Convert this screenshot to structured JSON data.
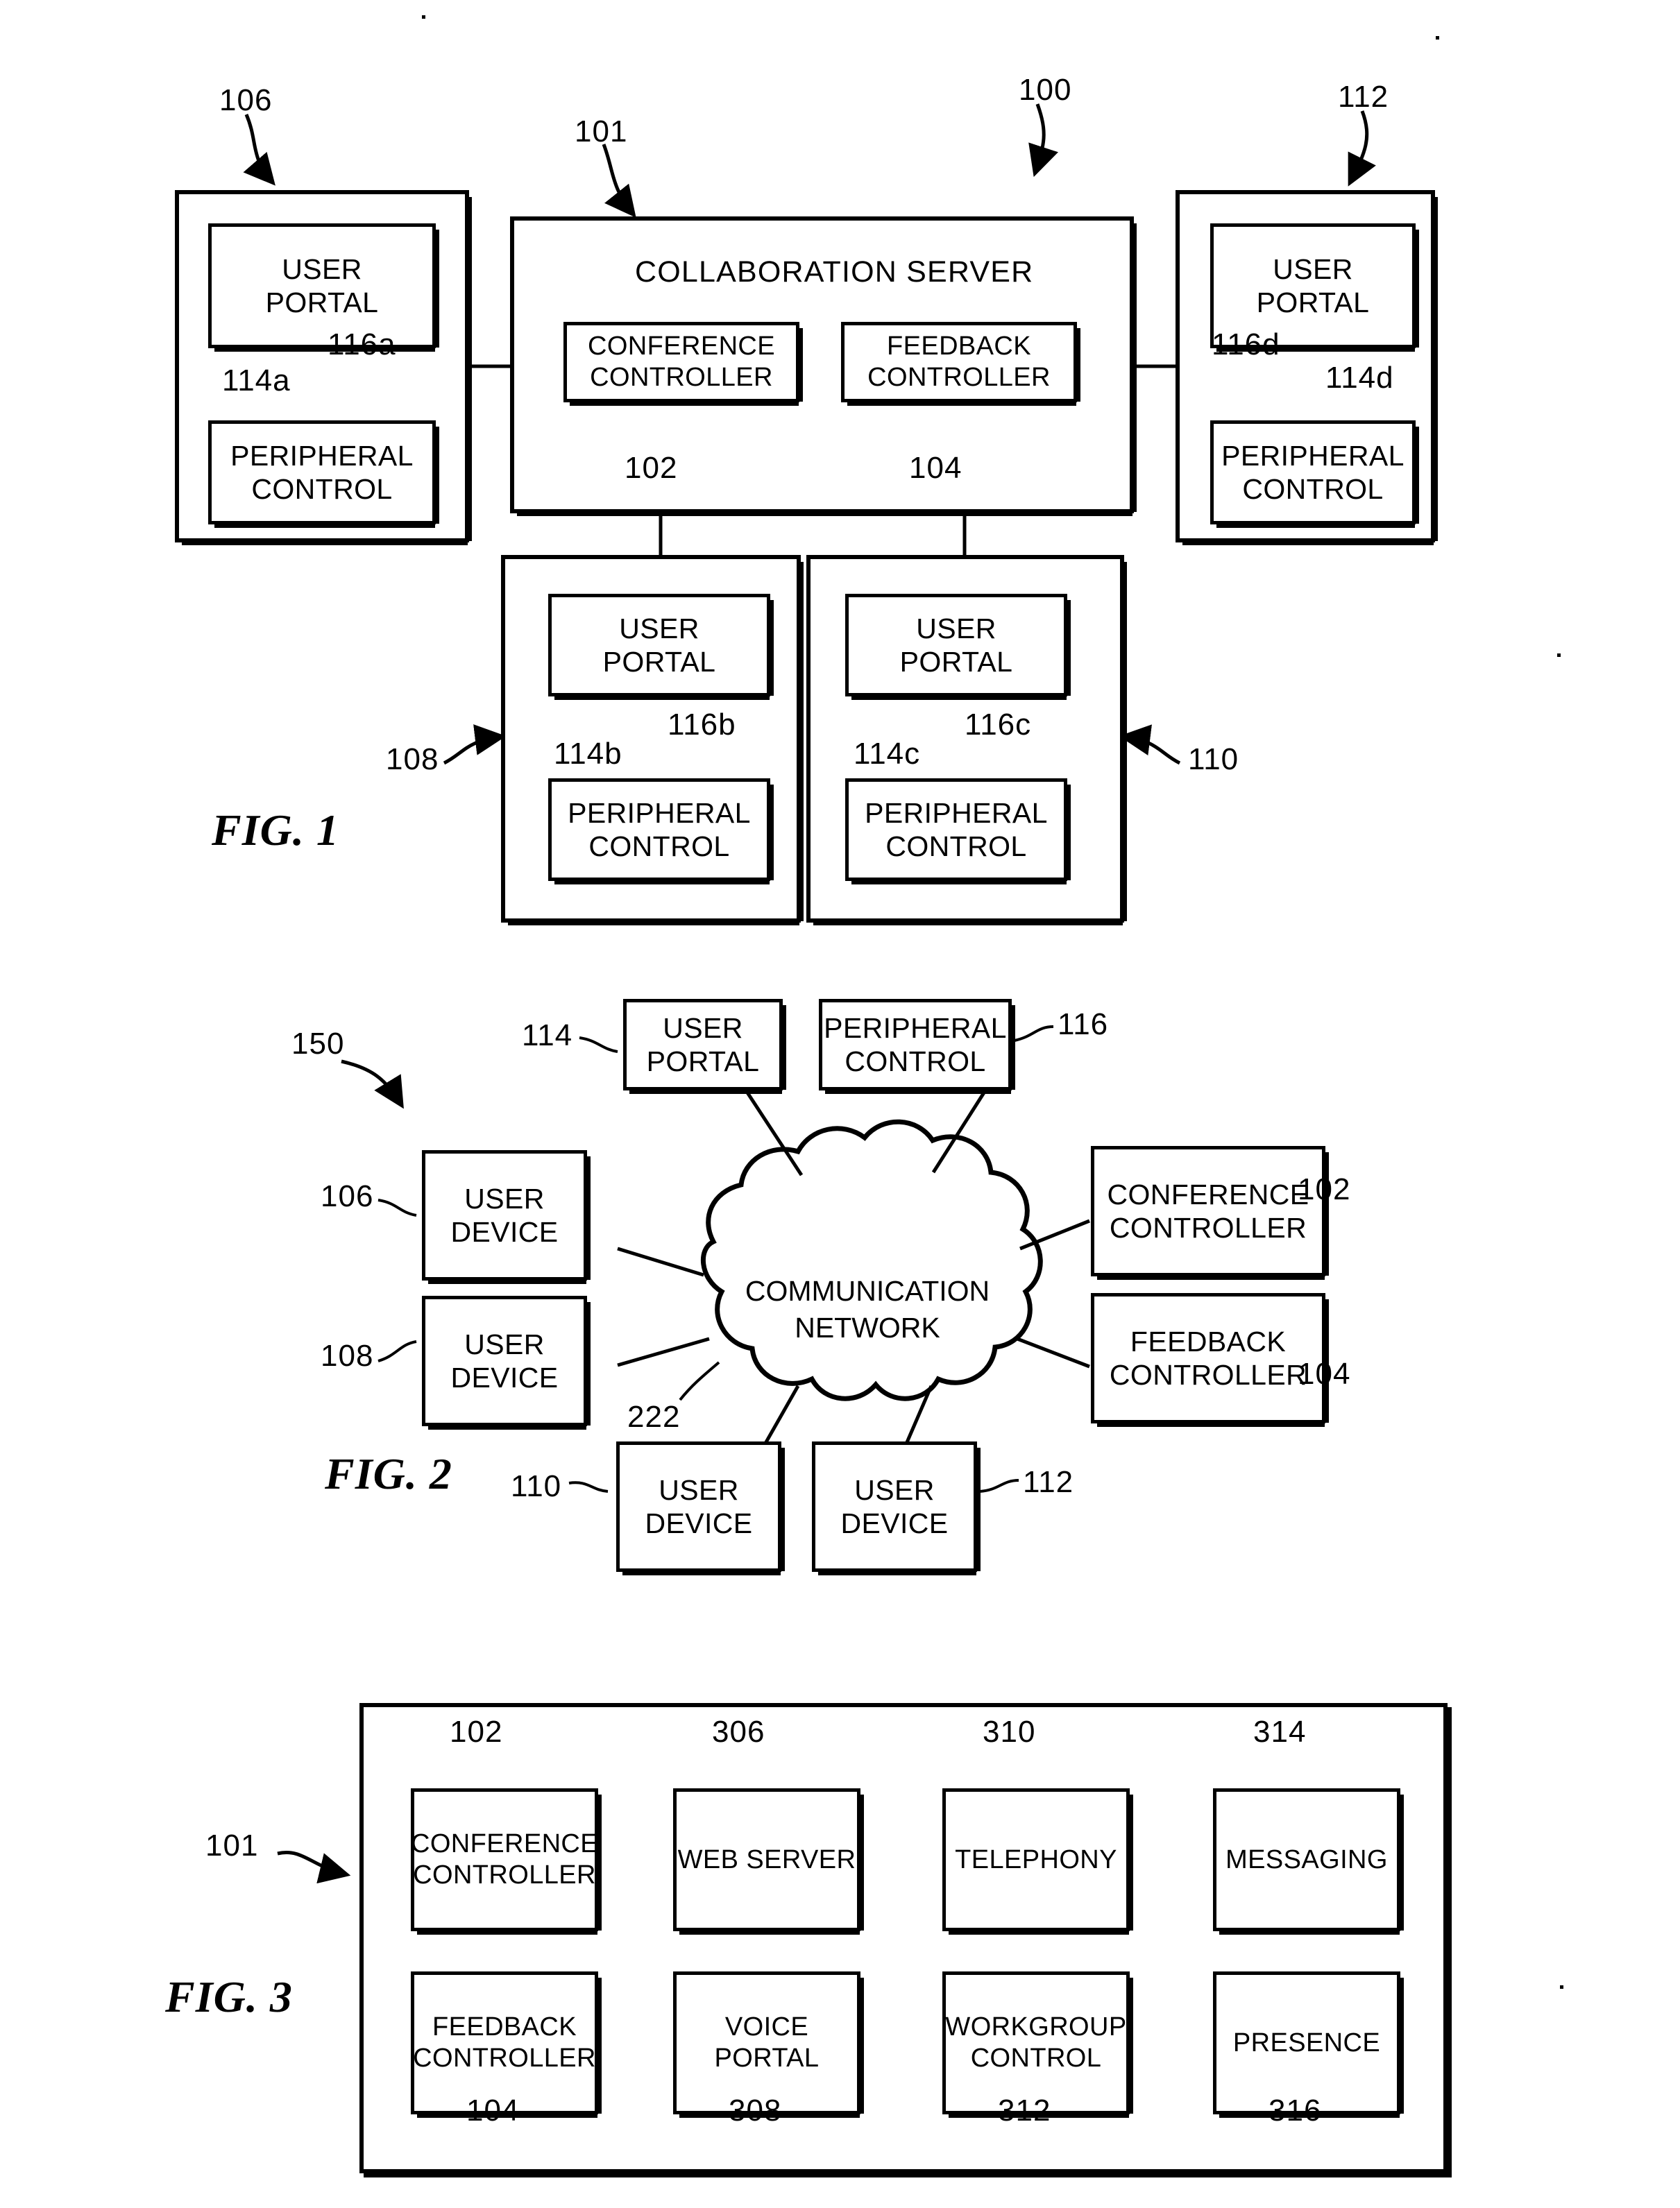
{
  "document": {
    "type": "patent-drawing-sheet",
    "figures": [
      "FIG. 1",
      "FIG. 2",
      "FIG. 3"
    ]
  },
  "fig1": {
    "caption": "FIG. 1",
    "system_ref": "100",
    "server": {
      "ref": "101",
      "title": "COLLABORATION SERVER",
      "modules": [
        {
          "label": "CONFERENCE\nCONTROLLER",
          "ref": "102"
        },
        {
          "label": "FEEDBACK\nCONTROLLER",
          "ref": "104"
        }
      ]
    },
    "devices": [
      {
        "ref": "106",
        "portal_label": "USER\nPORTAL",
        "portal_ref": "114a",
        "peripheral_label": "PERIPHERAL\nCONTROL",
        "peripheral_ref": "116a"
      },
      {
        "ref": "112",
        "portal_label": "USER\nPORTAL",
        "portal_ref": "114d",
        "peripheral_label": "PERIPHERAL\nCONTROL",
        "peripheral_ref": "116d"
      },
      {
        "ref": "108",
        "portal_label": "USER\nPORTAL",
        "portal_ref": "114b",
        "peripheral_label": "PERIPHERAL\nCONTROL",
        "peripheral_ref": "116b"
      },
      {
        "ref": "110",
        "portal_label": "USER\nPORTAL",
        "portal_ref": "114c",
        "peripheral_label": "PERIPHERAL\nCONTROL",
        "peripheral_ref": "116c"
      }
    ]
  },
  "fig2": {
    "caption": "FIG. 2",
    "system_ref": "150",
    "network": {
      "label": "COMMUNICATION\nNETWORK",
      "ref": "222"
    },
    "nodes": [
      {
        "label": "USER\nPORTAL",
        "ref": "114"
      },
      {
        "label": "PERIPHERAL\nCONTROL",
        "ref": "116"
      },
      {
        "label": "USER\nDEVICE",
        "ref": "106"
      },
      {
        "label": "USER\nDEVICE",
        "ref": "108"
      },
      {
        "label": "CONFERENCE\nCONTROLLER",
        "ref": "102"
      },
      {
        "label": "FEEDBACK\nCONTROLLER",
        "ref": "104"
      },
      {
        "label": "USER\nDEVICE",
        "ref": "110"
      },
      {
        "label": "USER\nDEVICE",
        "ref": "112"
      }
    ]
  },
  "fig3": {
    "caption": "FIG. 3",
    "container_ref": "101",
    "row1": [
      {
        "label": "CONFERENCE\nCONTROLLER",
        "ref": "102"
      },
      {
        "label": "WEB SERVER",
        "ref": "306"
      },
      {
        "label": "TELEPHONY",
        "ref": "310"
      },
      {
        "label": "MESSAGING",
        "ref": "314"
      }
    ],
    "row2": [
      {
        "label": "FEEDBACK\nCONTROLLER",
        "ref": "104"
      },
      {
        "label": "VOICE\nPORTAL",
        "ref": "308"
      },
      {
        "label": "WORKGROUP\nCONTROL",
        "ref": "312"
      },
      {
        "label": "PRESENCE",
        "ref": "316"
      }
    ]
  },
  "colors": {
    "ink": "#000000",
    "paper": "#ffffff"
  }
}
